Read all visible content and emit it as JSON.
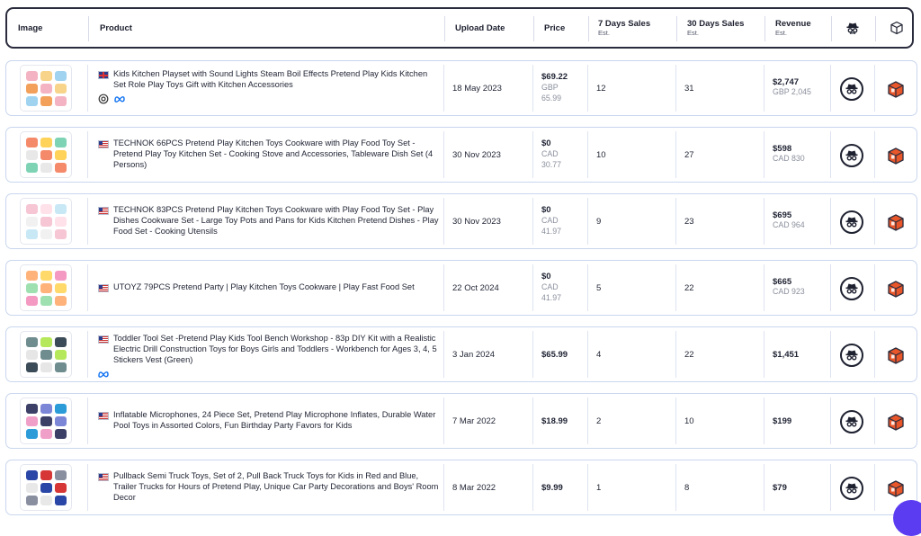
{
  "header": {
    "image": "Image",
    "product": "Product",
    "upload_date": "Upload Date",
    "price": "Price",
    "sales7": "7 Days Sales",
    "sales7_sub": "Est.",
    "sales30": "30 Days Sales",
    "sales30_sub": "Est.",
    "revenue": "Revenue",
    "revenue_sub": "Est."
  },
  "rows": [
    {
      "flag": "uk",
      "title": "Kids Kitchen Playset with Sound Lights Steam Boil Effects Pretend Play Kids Kitchen Set Role Play Toys Gift with Kitchen Accessories",
      "date": "18 May 2023",
      "price": "$69.22",
      "price_cur": "GBP",
      "price_orig": "65.99",
      "s7": "12",
      "s30": "31",
      "revenue": "$2,747",
      "revenue_sub": "GBP 2,045",
      "icons": [
        "openai-icon",
        "meta-icon"
      ]
    },
    {
      "flag": "us",
      "title": "TECHNOK 66PCS Pretend Play Kitchen Toys Cookware with Play Food Toy Set - Pretend Play Toy Kitchen Set - Cooking Stove and Accessories, Tableware Dish Set (4 Persons)",
      "date": "30 Nov 2023",
      "price": "$0",
      "price_cur": "CAD",
      "price_orig": "30.77",
      "s7": "10",
      "s30": "27",
      "revenue": "$598",
      "revenue_sub": "CAD 830",
      "icons": []
    },
    {
      "flag": "us",
      "title": "TECHNOK 83PCS Pretend Play Kitchen Toys Cookware with Play Food Toy Set - Play Dishes Cookware Set - Large Toy Pots and Pans for Kids Kitchen Pretend Dishes - Play Food Set - Cooking Utensils",
      "date": "30 Nov 2023",
      "price": "$0",
      "price_cur": "CAD",
      "price_orig": "41.97",
      "s7": "9",
      "s30": "23",
      "revenue": "$695",
      "revenue_sub": "CAD 964",
      "icons": []
    },
    {
      "flag": "us",
      "title": "UTOYZ 79PCS Pretend Party | Play Kitchen Toys Cookware | Play Fast Food Set",
      "date": "22 Oct 2024",
      "price": "$0",
      "price_cur": "CAD",
      "price_orig": "41.97",
      "s7": "5",
      "s30": "22",
      "revenue": "$665",
      "revenue_sub": "CAD 923",
      "icons": []
    },
    {
      "flag": "us",
      "title": "Toddler Tool Set -Pretend Play Kids Tool Bench Workshop - 83p DIY Kit with a Realistic Electric Drill Construction Toys for Boys Girls and Toddlers - Workbench for Ages 3, 4, 5 Stickers Vest (Green)",
      "date": "3 Jan 2024",
      "price": "$65.99",
      "price_cur": "",
      "price_orig": "",
      "s7": "4",
      "s30": "22",
      "revenue": "$1,451",
      "revenue_sub": "",
      "icons": [
        "meta-icon"
      ]
    },
    {
      "flag": "us",
      "title": "Inflatable Microphones, 24 Piece Set, Pretend Play Microphone Inflates, Durable Water Pool Toys in Assorted Colors, Fun Birthday Party Favors for Kids",
      "date": "7 Mar 2022",
      "price": "$18.99",
      "price_cur": "",
      "price_orig": "",
      "s7": "2",
      "s30": "10",
      "revenue": "$199",
      "revenue_sub": "",
      "icons": []
    },
    {
      "flag": "us",
      "title": "Pullback Semi Truck Toys, Set of 2, Pull Back Truck Toys for Kids in Red and Blue, Trailer Trucks for Hours of Pretend Play, Unique Car Party Decorations and Boys' Room Decor",
      "date": "8 Mar 2022",
      "price": "$9.99",
      "price_cur": "",
      "price_orig": "",
      "s7": "1",
      "s30": "8",
      "revenue": "$79",
      "revenue_sub": "",
      "icons": []
    }
  ],
  "colors": {
    "accent": "#5b3cf0",
    "border": "#c9d6ee",
    "box_orange": "#e8562a"
  },
  "header_icons": [
    "spy-icon",
    "box-icon"
  ]
}
